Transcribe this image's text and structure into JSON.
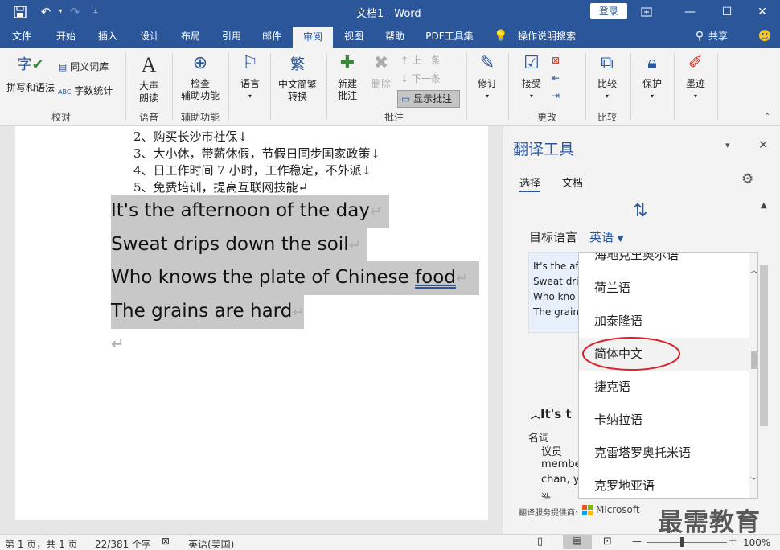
{
  "titlebar": {
    "title": "文档1  -  Word",
    "login": "登录",
    "undo": "↶",
    "redo": "↷",
    "more": "⋯"
  },
  "tabs": [
    "文件",
    "开始",
    "插入",
    "设计",
    "布局",
    "引用",
    "邮件",
    "审阅",
    "视图",
    "帮助",
    "PDF工具集",
    "操作说明搜索",
    "共享"
  ],
  "ribbon": {
    "spell": "拼写和语法",
    "thesaurus": "同义词库",
    "wordcount": "字数统计",
    "g_proof": "校对",
    "read1": "大声",
    "read2": "朗读",
    "g_speech": "语音",
    "check1": "检查",
    "check2": "辅助功能",
    "g_access": "辅助功能",
    "lang": "语言",
    "conv1": "中文简繁",
    "conv2": "转换",
    "new1": "新建",
    "new2": "批注",
    "delete": "删除",
    "prev": "上一条",
    "next": "下一条",
    "show": "显示批注",
    "g_comment": "批注",
    "track": "修订",
    "accept": "接受",
    "g_changes": "更改",
    "compare": "比较",
    "g_compare": "比较",
    "protect": "保护",
    "ink": "墨迹"
  },
  "doc": {
    "lines_cn": [
      "2、购买长沙市社保↓",
      "3、大小休，带薪休假，节假日同步国家政策↓",
      "4、日工作时间 7 小时，工作稳定，不外派↓",
      "5、免费培训，提高互联网技能↵"
    ],
    "en1": "It's the afternoon of the day",
    "en2": "Sweat drips down the soil",
    "en3a": "Who knows the plate of Chinese ",
    "en3b": "food",
    "en4": "The grains are hard",
    "mark": "↵"
  },
  "pane": {
    "title": "翻译工具",
    "tab_select": "选择",
    "tab_doc": "文档",
    "target_label": "目标语言",
    "target_value": "英语",
    "preview": [
      "It's the af",
      "Sweat dri",
      "Who kno",
      "The grain"
    ],
    "heading": "It's t",
    "pos": "名词",
    "word1": "议员",
    "word2": "membe",
    "word3": "chan, y",
    "word4": "浩",
    "provider": "翻译服务提供商:",
    "provider_name": "Microsoft",
    "languages": [
      "海地克里奥尔语",
      "荷兰语",
      "加泰隆语",
      "简体中文",
      "捷克语",
      "卡纳拉语",
      "克雷塔罗奥托米语",
      "克罗地亚语"
    ]
  },
  "watermark": "最需教育",
  "status": {
    "page": "第 1 页，共 1 页",
    "words": "22/381 个字",
    "lang": "英语(美国)",
    "zoom": "100%"
  },
  "colors": {
    "word_blue": "#2b579a",
    "highlight": "#c8c8c8",
    "circle": "#d9232d"
  }
}
